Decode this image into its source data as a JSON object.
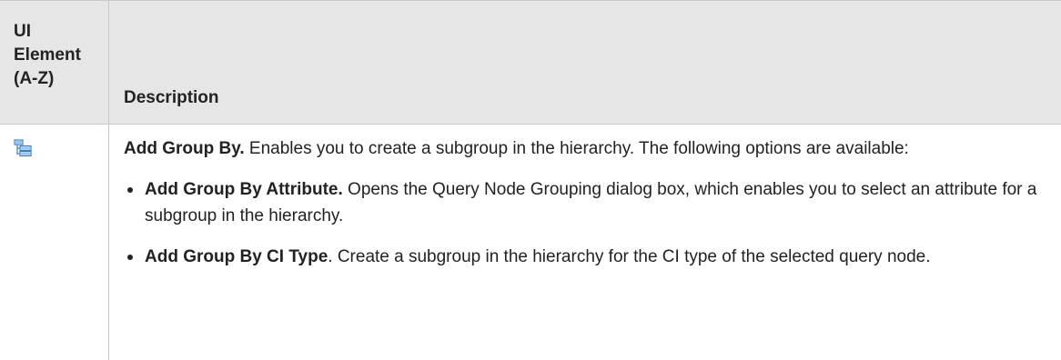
{
  "table": {
    "header": {
      "col1": "UI\nElement\n(A-Z)",
      "col2": "Description"
    },
    "rows": [
      {
        "icon": "add-group-by-icon",
        "term": "Add Group By.",
        "description": " Enables you to create a subgroup in the hierarchy. The following options are available:",
        "options": [
          {
            "term": "Add Group By Attribute.",
            "text": " Opens the Query Node Grouping dialog box, which enables you to select an attribute for a subgroup in the hierarchy."
          },
          {
            "term": "Add Group By CI Type",
            "text": ". Create a subgroup in the hierarchy for the CI type of the selected query node."
          }
        ]
      }
    ]
  },
  "colors": {
    "header_bg": "#e6e6e6",
    "border": "#c8c8c8",
    "text": "#222222",
    "icon_blue": "#3a7fc2"
  }
}
